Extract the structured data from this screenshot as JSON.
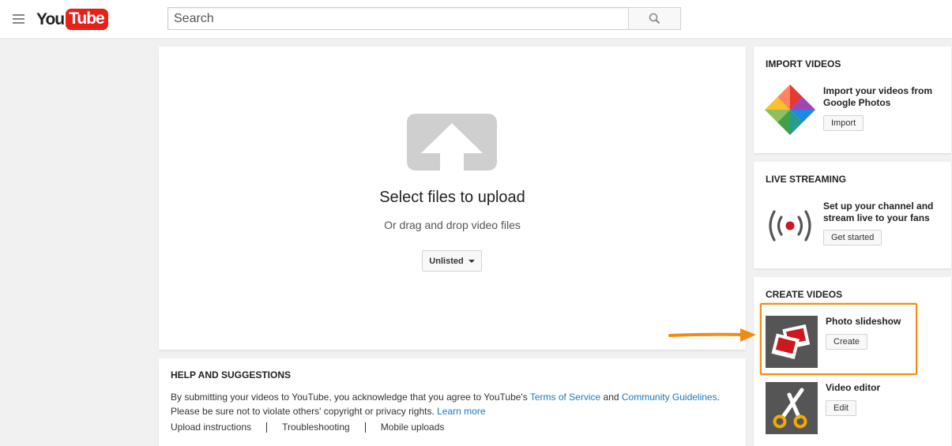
{
  "header": {
    "logo_you": "You",
    "logo_tube": "Tube",
    "search_placeholder": "Search"
  },
  "upload": {
    "title": "Select files to upload",
    "subtitle": "Or drag and drop video files",
    "privacy_value": "Unlisted"
  },
  "help": {
    "title": "HELP AND SUGGESTIONS",
    "text_1": "By submitting your videos to YouTube, you acknowledge that you agree to YouTube's ",
    "tos_link": "Terms of Service",
    "and": " and ",
    "guidelines_link": "Community Guidelines",
    "text_2": ".",
    "text_3": "Please be sure not to violate others' copyright or privacy rights. ",
    "learn_more": "Learn more",
    "links": [
      "Upload instructions",
      "Troubleshooting",
      "Mobile uploads"
    ]
  },
  "import": {
    "title": "IMPORT VIDEOS",
    "desc": "Import your videos from Google Photos",
    "button": "Import"
  },
  "live": {
    "title": "LIVE STREAMING",
    "desc": "Set up your channel and stream live to your fans",
    "button": "Get started"
  },
  "create": {
    "title": "CREATE VIDEOS",
    "slideshow_label": "Photo slideshow",
    "slideshow_button": "Create",
    "editor_label": "Video editor",
    "editor_button": "Edit"
  },
  "colors": {
    "brand_red": "#e62117",
    "link_blue": "#167ac6",
    "highlight_orange": "#f08c14"
  }
}
